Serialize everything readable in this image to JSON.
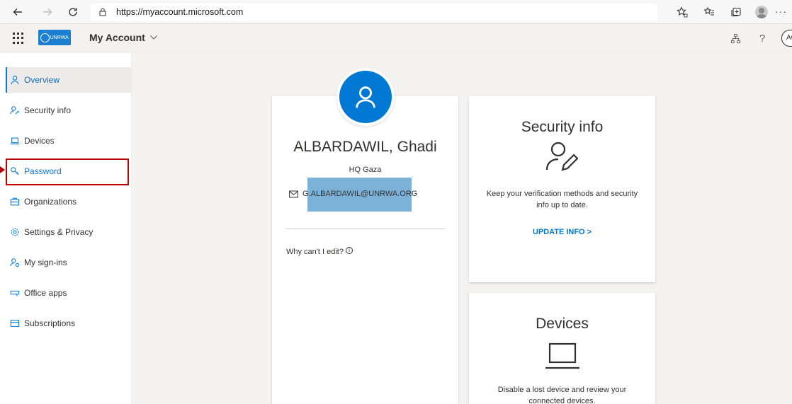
{
  "browser": {
    "url_prefix": "https://",
    "url_host": "myaccount.microsoft.com"
  },
  "header": {
    "app_title": "My Account",
    "org_logo_text": "UNRWA",
    "avatar_initials": "AG"
  },
  "sidebar": {
    "items": [
      {
        "label": "Overview",
        "icon": "person-icon",
        "active": true
      },
      {
        "label": "Security info",
        "icon": "person-key-icon"
      },
      {
        "label": "Devices",
        "icon": "laptop-icon"
      },
      {
        "label": "Password",
        "icon": "key-icon"
      },
      {
        "label": "Organizations",
        "icon": "briefcase-icon"
      },
      {
        "label": "Settings & Privacy",
        "icon": "gear-icon"
      },
      {
        "label": "My sign-ins",
        "icon": "person-key-icon"
      },
      {
        "label": "Office apps",
        "icon": "office-apps-icon"
      },
      {
        "label": "Subscriptions",
        "icon": "card-icon"
      }
    ]
  },
  "profile": {
    "name": "ALBARDAWIL, Ghadi",
    "org": "HQ Gaza",
    "email": "G.ALBARDAWIL@UNRWA.ORG",
    "cant_edit": "Why can't I edit?"
  },
  "security_info": {
    "title": "Security info",
    "description": "Keep your verification methods and security info up to date.",
    "link": "UPDATE INFO >"
  },
  "devices": {
    "title": "Devices",
    "description": "Disable a lost device and review your connected devices."
  },
  "colors": {
    "accent": "#0078d4",
    "highlight_red": "#c00000"
  }
}
